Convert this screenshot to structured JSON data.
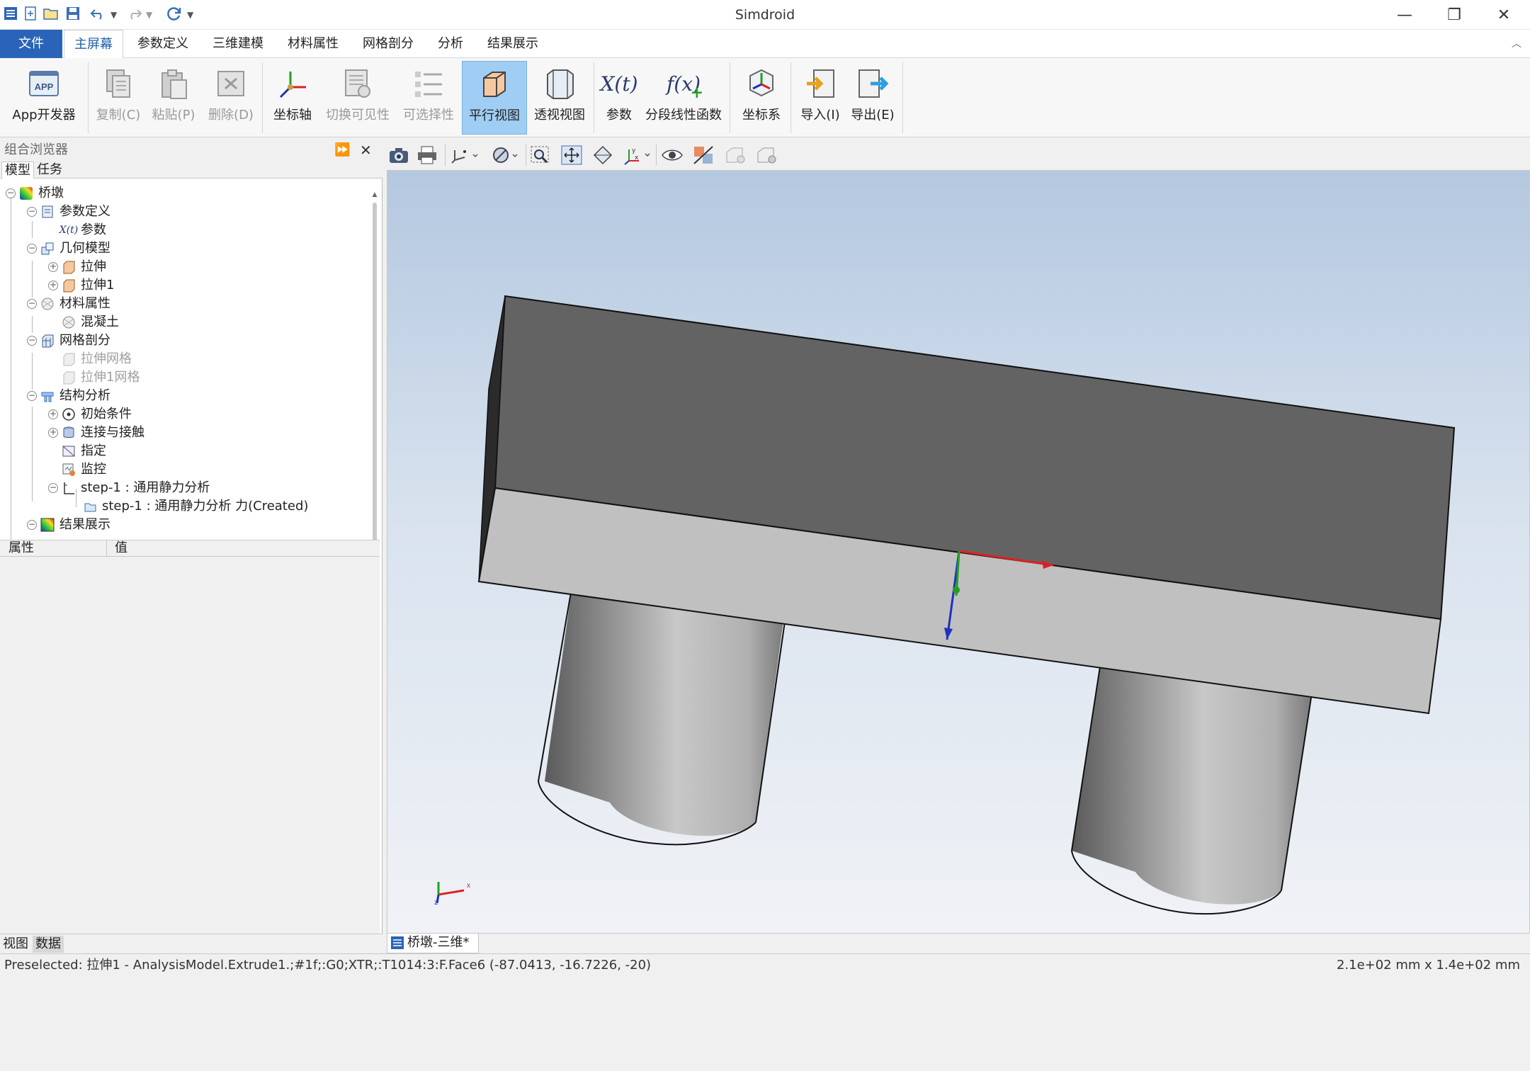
{
  "window": {
    "title": "Simdroid",
    "minimize": "—",
    "restore": "❐",
    "close": "✕"
  },
  "quick_access": {
    "collapse_ribbon": "︿"
  },
  "menu": {
    "tabs": [
      "文件",
      "主屏幕",
      "参数定义",
      "三维建模",
      "材料属性",
      "网格剖分",
      "分析",
      "结果展示"
    ],
    "active": "主屏幕"
  },
  "ribbon": {
    "app_developer": "App开发器",
    "copy": "复制(C)",
    "paste": "粘贴(P)",
    "delete": "删除(D)",
    "axis": "坐标轴",
    "toggle_visibility": "切换可见性",
    "selectability": "可选择性",
    "parallel_view": "平行视图",
    "perspective_view": "透视视图",
    "parameters": "参数",
    "piecewise_linear": "分段线性函数",
    "coordinate_system": "坐标系",
    "import": "导入(I)",
    "export": "导出(E)",
    "app_icon_text": "APP",
    "xt_icon_text": "X(t)",
    "fx_icon_text": "f(x)"
  },
  "browser": {
    "title": "组合浏览器",
    "tabs": [
      "模型",
      "任务"
    ],
    "tree": {
      "root": "桥墩",
      "param_def": "参数定义",
      "params": "参数",
      "geometry": "几何模型",
      "extrude": "拉伸",
      "extrude1": "拉伸1",
      "material": "材料属性",
      "concrete": "混凝土",
      "mesh": "网格剖分",
      "extrude_mesh": "拉伸网格",
      "extrude1_mesh": "拉伸1网格",
      "structural": "结构分析",
      "initial_cond": "初始条件",
      "connection": "连接与接触",
      "assign": "指定",
      "monitor": "监控",
      "step1": "step-1 : 通用静力分析",
      "step1_force": "step-1 : 通用静力分析 力(Created)",
      "results": "结果展示"
    }
  },
  "properties": {
    "col_property": "属性",
    "col_value": "值"
  },
  "bottom_tabs": [
    "视图",
    "数据"
  ],
  "viewport": {
    "doc_tab": "桥墩-三维*",
    "axis_x": "x",
    "axis_z": "z"
  },
  "status": {
    "message": "Preselected: 拉伸1 - AnalysisModel.Extrude1.;#1f;:G0;XTR;:T1014:3:F.Face6 (-87.0413, -16.7226, -20)",
    "dimensions": "2.1e+02 mm x 1.4e+02 mm"
  },
  "colors": {
    "accent": "#2a64b8",
    "selected": "#9fcdf4",
    "x_axis": "#e02020",
    "y_axis": "#20a020",
    "z_axis": "#2030c0"
  }
}
